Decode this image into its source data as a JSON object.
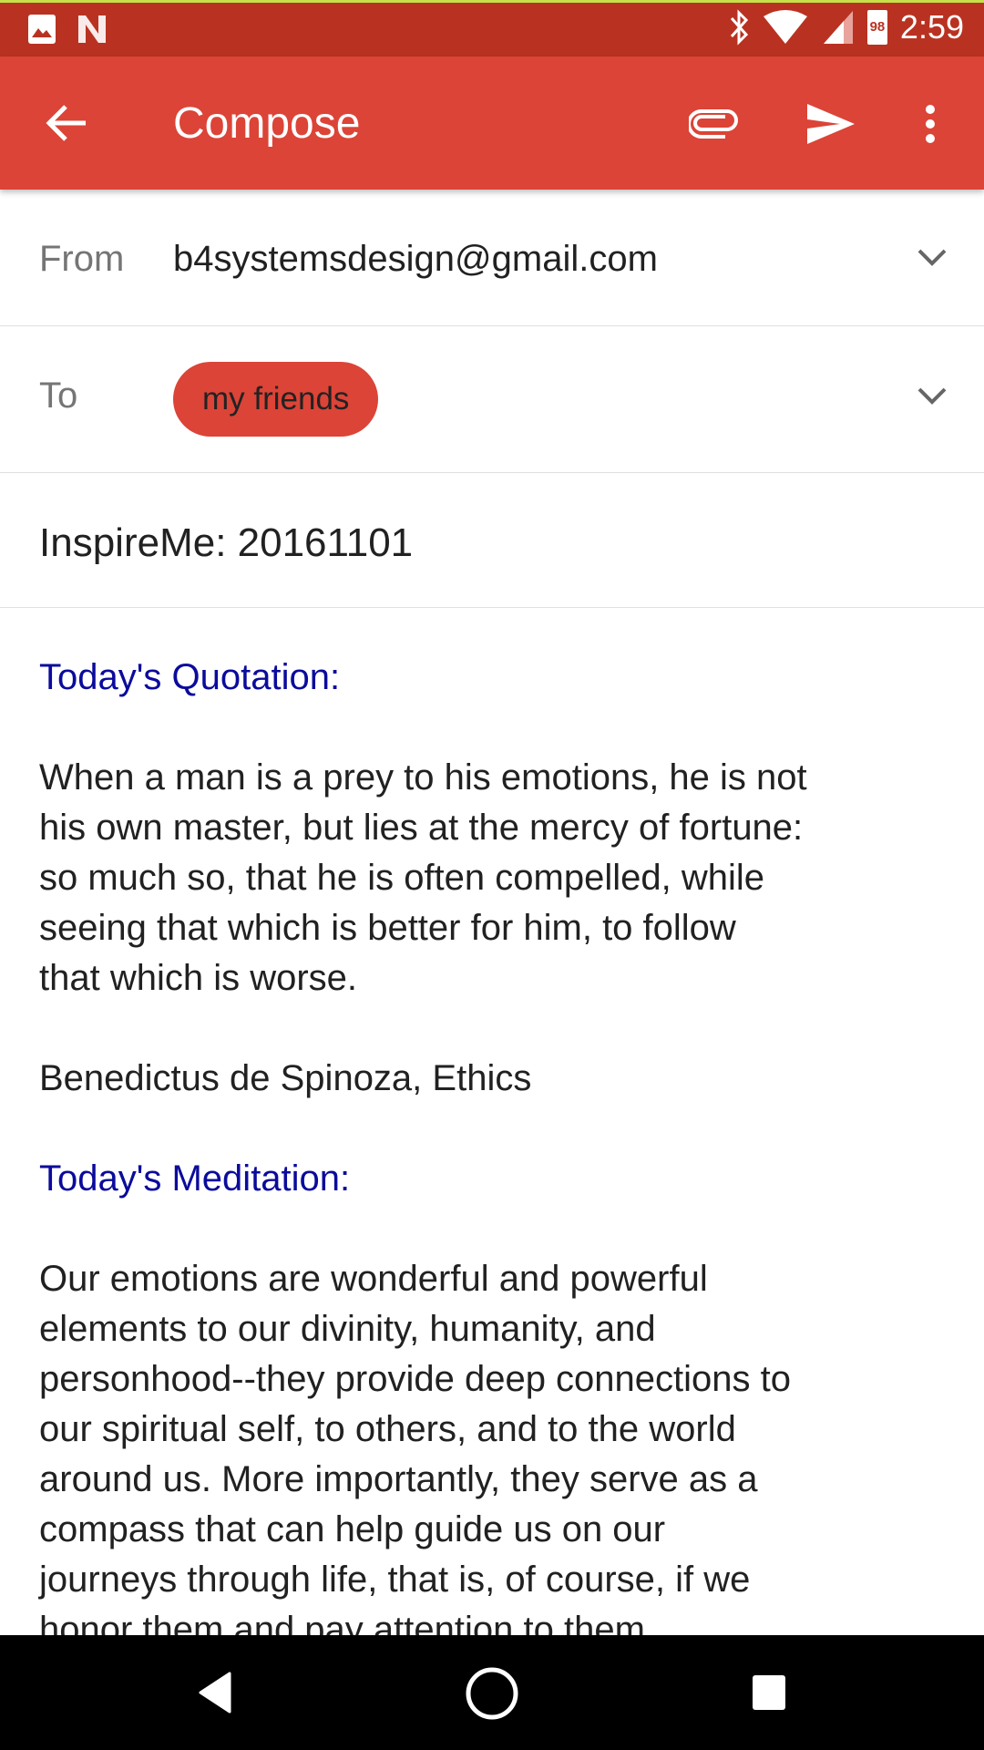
{
  "status_bar": {
    "time": "2:59",
    "battery": "98",
    "icons": [
      "image-icon",
      "n-logo-icon",
      "bluetooth-icon",
      "wifi-icon",
      "signal-icon",
      "battery-icon"
    ]
  },
  "app_bar": {
    "title": "Compose",
    "icons": [
      "back-arrow-icon",
      "attach-icon",
      "send-icon",
      "more-vert-icon"
    ]
  },
  "from": {
    "label": "From",
    "value": "b4systemsdesign@gmail.com"
  },
  "to": {
    "label": "To",
    "chip": "my friends"
  },
  "subject": "InspireMe: 20161101",
  "body": {
    "quotation_heading": "Today's Quotation:",
    "quotation_lines": [
      "When a man is a prey to his emotions, he is not",
      "his own master, but lies at the mercy of fortune:",
      "so much so, that he is often compelled, while",
      "seeing that which is better for him, to follow",
      "that which is worse."
    ],
    "attribution": "Benedictus de Spinoza, Ethics",
    "meditation_heading": "Today's Meditation:",
    "meditation_lines": [
      "Our emotions are wonderful and powerful",
      "elements to our divinity, humanity, and",
      "personhood--they provide deep connections to",
      "our spiritual self, to others, and to the world",
      "around us. More importantly, they serve as a",
      "compass that can help guide us on our",
      "journeys through life, that is, of course, if we",
      "honor them and pay attention to them."
    ]
  },
  "colors": {
    "status_bar": "#b93221",
    "app_bar": "#db4437",
    "chip": "#db4437",
    "heading": "#0b0b9c"
  }
}
